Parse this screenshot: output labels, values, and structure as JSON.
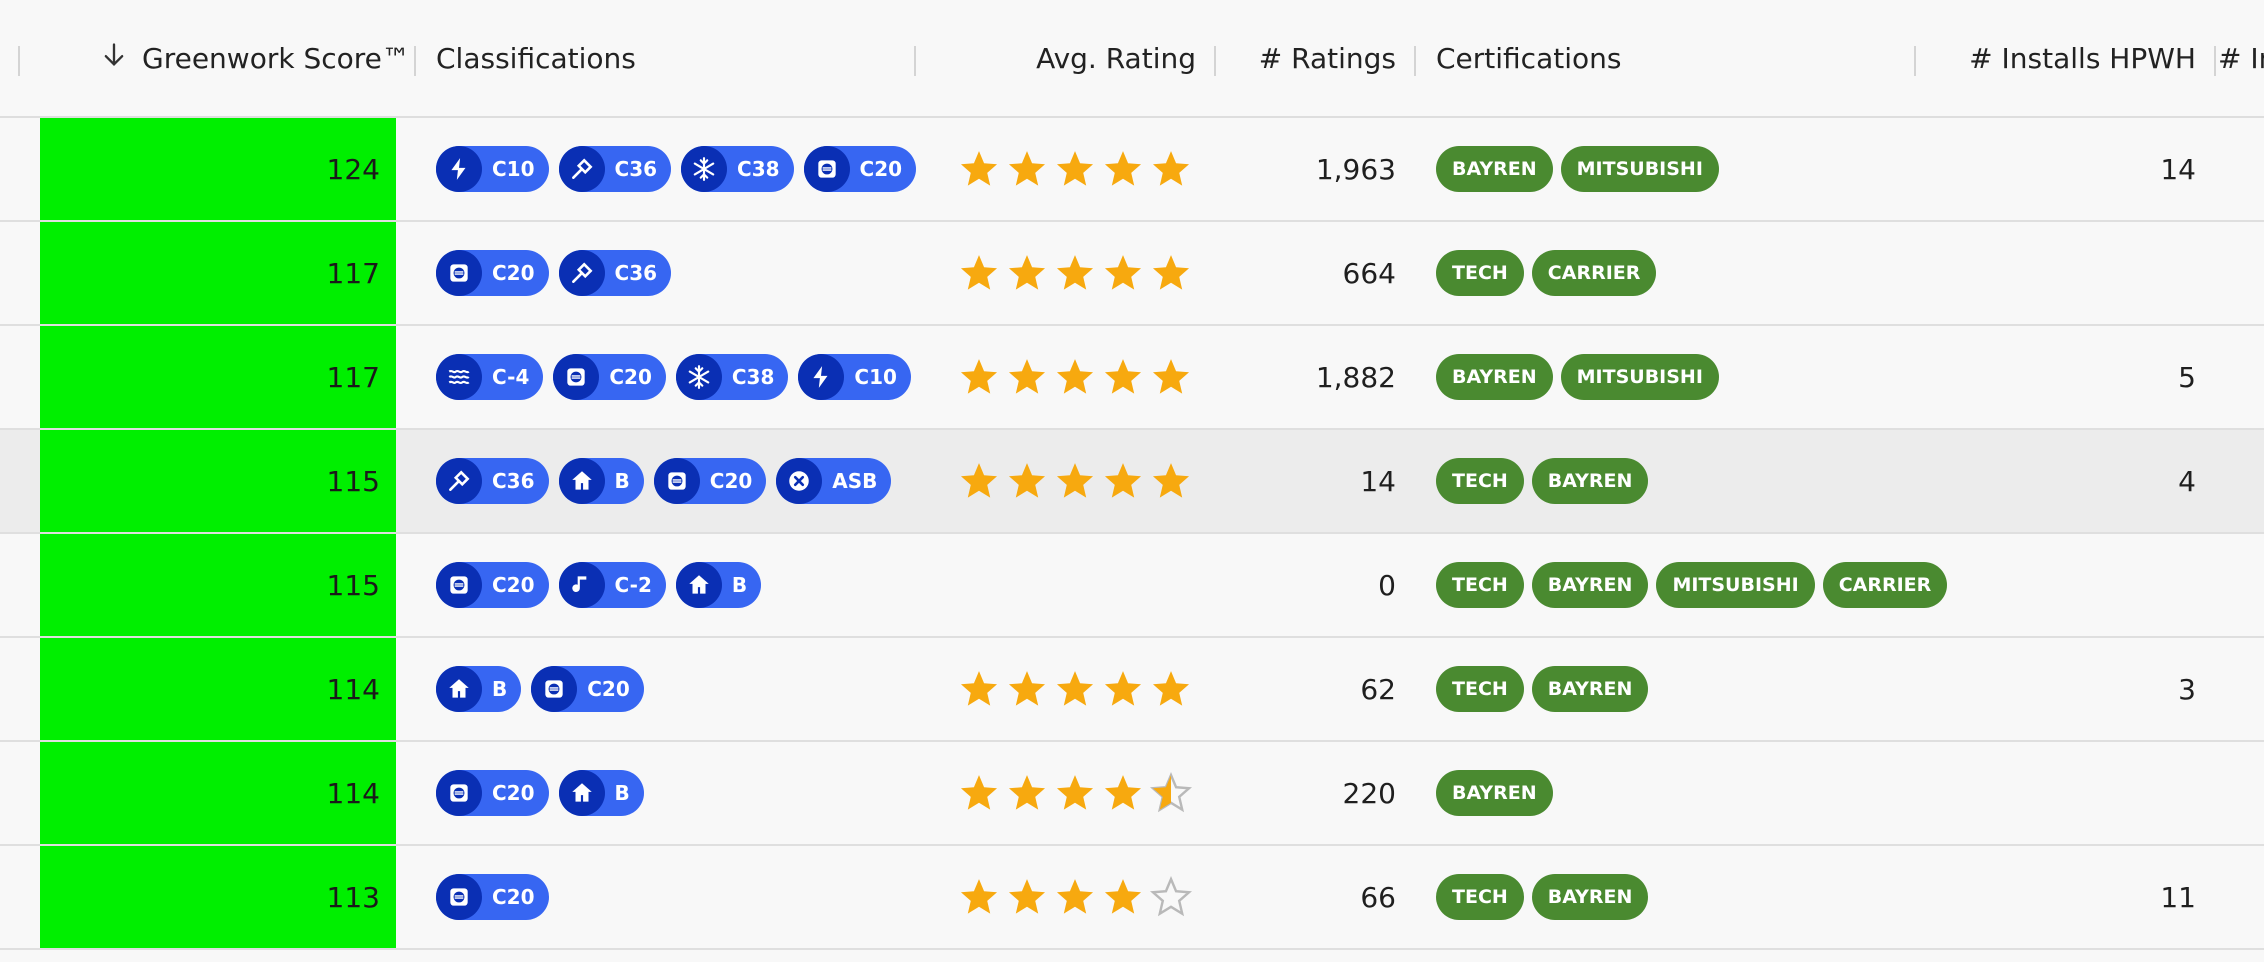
{
  "header": {
    "score": "Greenwork Score™",
    "classifications": "Classifications",
    "avg_rating": "Avg. Rating",
    "ratings": "# Ratings",
    "certifications": "Certifications",
    "installs": "# Installs HPWH",
    "next_col": "# In"
  },
  "colors": {
    "score_bg": "#00ef00",
    "class_pill": "#3766f2",
    "class_icon": "#0a2fb4",
    "cert_pill": "#4a8a30",
    "star": "#f7a90f"
  },
  "rows": [
    {
      "score": "124",
      "classes": [
        {
          "icon": "lightning-icon",
          "label": "C10"
        },
        {
          "icon": "wrench-icon",
          "label": "C36"
        },
        {
          "icon": "snowflake-icon",
          "label": "C38"
        },
        {
          "icon": "panel-icon",
          "label": "C20"
        }
      ],
      "rating": 5,
      "ratings": "1,963",
      "certs": [
        "BAYREN",
        "MITSUBISHI"
      ],
      "installs": "14"
    },
    {
      "score": "117",
      "classes": [
        {
          "icon": "panel-icon",
          "label": "C20"
        },
        {
          "icon": "wrench-icon",
          "label": "C36"
        }
      ],
      "rating": 5,
      "ratings": "664",
      "certs": [
        "TECH",
        "CARRIER"
      ],
      "installs": ""
    },
    {
      "score": "117",
      "classes": [
        {
          "icon": "waves-icon",
          "label": "C-4"
        },
        {
          "icon": "panel-icon",
          "label": "C20"
        },
        {
          "icon": "snowflake-icon",
          "label": "C38"
        },
        {
          "icon": "lightning-icon",
          "label": "C10"
        }
      ],
      "rating": 5,
      "ratings": "1,882",
      "certs": [
        "BAYREN",
        "MITSUBISHI"
      ],
      "installs": "5"
    },
    {
      "score": "115",
      "classes": [
        {
          "icon": "wrench-icon",
          "label": "C36"
        },
        {
          "icon": "house-icon",
          "label": "B"
        },
        {
          "icon": "panel-icon",
          "label": "C20"
        },
        {
          "icon": "x-circle-icon",
          "label": "ASB"
        }
      ],
      "rating": 5,
      "ratings": "14",
      "certs": [
        "TECH",
        "BAYREN"
      ],
      "installs": "4"
    },
    {
      "score": "115",
      "classes": [
        {
          "icon": "panel-icon",
          "label": "C20"
        },
        {
          "icon": "music-note-icon",
          "label": "C-2"
        },
        {
          "icon": "house-icon",
          "label": "B"
        }
      ],
      "rating": null,
      "ratings": "0",
      "certs": [
        "TECH",
        "BAYREN",
        "MITSUBISHI",
        "CARRIER"
      ],
      "installs": ""
    },
    {
      "score": "114",
      "classes": [
        {
          "icon": "house-icon",
          "label": "B"
        },
        {
          "icon": "panel-icon",
          "label": "C20"
        }
      ],
      "rating": 5,
      "ratings": "62",
      "certs": [
        "TECH",
        "BAYREN"
      ],
      "installs": "3"
    },
    {
      "score": "114",
      "classes": [
        {
          "icon": "panel-icon",
          "label": "C20"
        },
        {
          "icon": "house-icon",
          "label": "B"
        }
      ],
      "rating": 4.5,
      "ratings": "220",
      "certs": [
        "BAYREN"
      ],
      "installs": ""
    },
    {
      "score": "113",
      "classes": [
        {
          "icon": "panel-icon",
          "label": "C20"
        }
      ],
      "rating": 4,
      "ratings": "66",
      "certs": [
        "TECH",
        "BAYREN"
      ],
      "installs": "11"
    }
  ]
}
